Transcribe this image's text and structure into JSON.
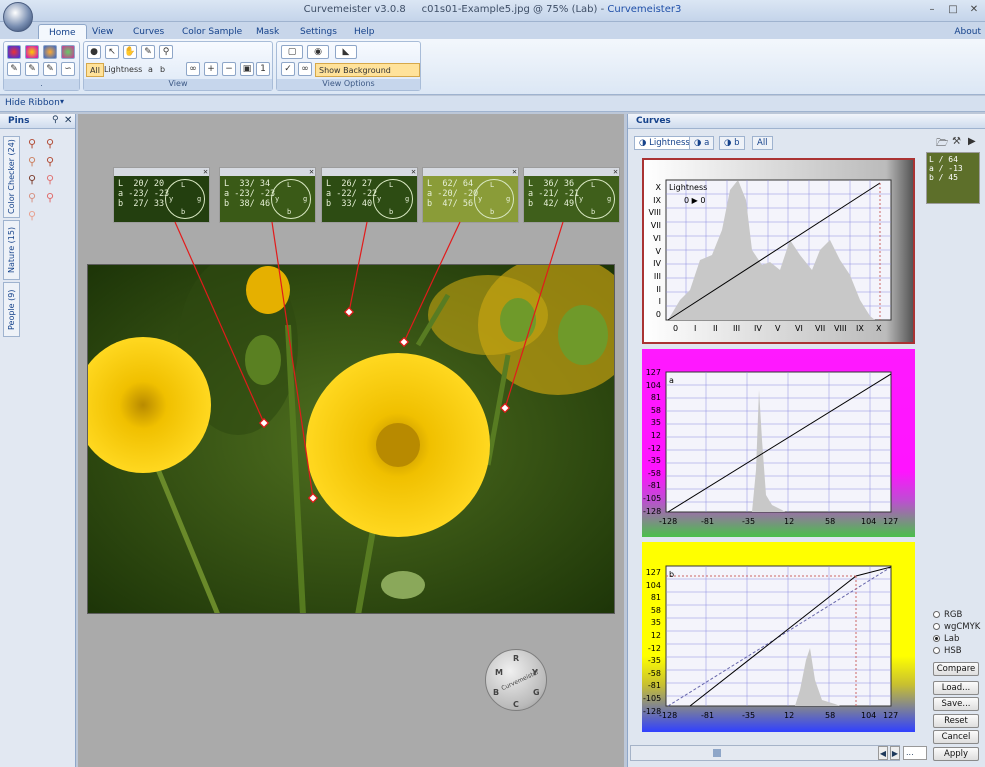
{
  "titlebar": {
    "app": "Curvemeister v3.0.8",
    "doc": "c01s01-Example5.jpg @ 75% (Lab)",
    "separator": "-",
    "brand": "Curvemeister3"
  },
  "tabs": [
    "Home",
    "View",
    "Curves",
    "Color Sample",
    "Mask",
    "Settings",
    "Help"
  ],
  "about": "About",
  "ribbon": {
    "group2_label": "View",
    "group3_label": "View Options",
    "channel_chips": [
      "All",
      "Lightness",
      "a",
      "b"
    ],
    "show_bg": "Show Background Layers",
    "dot_label": "."
  },
  "hide_ribbon": "Hide Ribbon",
  "pins": {
    "title": "Pins",
    "tabs": [
      "Color Checker (24)",
      "Nature (15)",
      "People (9)"
    ]
  },
  "samplers": [
    {
      "L": "L  20/ 20",
      "a": "a -23/ -23",
      "b": "b  27/ 33",
      "bg": "#233f0f"
    },
    {
      "L": "L  33/ 34",
      "a": "a -23/ -23",
      "b": "b  38/ 46",
      "bg": "#3a5a17"
    },
    {
      "L": "L  26/ 27",
      "a": "a -22/ -22",
      "b": "b  33/ 40",
      "bg": "#2d4c13"
    },
    {
      "L": "L  62/ 64",
      "a": "a -20/ -20",
      "b": "b  47/ 56",
      "bg": "#8a9c38"
    },
    {
      "L": "L  36/ 36",
      "a": "a -21/ -21",
      "b": "b  42/ 49",
      "bg": "#3f5f1b"
    }
  ],
  "clock_letters": {
    "L": "L",
    "a": "a",
    "b": "b",
    "y": "y",
    "g": "g"
  },
  "wheel": {
    "letters": [
      "M",
      "R",
      "Y",
      "B",
      "C",
      "G"
    ],
    "text": "Curvemeister"
  },
  "curves": {
    "title": "Curves",
    "tabs": [
      "Lightness",
      "a",
      "b",
      "All"
    ],
    "lightness": {
      "name": "Lightness",
      "io": "0 ▶ 0",
      "ylabels": [
        "X",
        "IX",
        "VIII",
        "VII",
        "VI",
        "V",
        "IV",
        "III",
        "II",
        "I",
        "0"
      ],
      "xlabels": [
        "0",
        "I",
        "II",
        "III",
        "IV",
        "V",
        "VI",
        "VII",
        "VIII",
        "IX",
        "X"
      ]
    },
    "a": {
      "name": "a",
      "ylabels": [
        "127",
        "104",
        "81",
        "58",
        "35",
        "12",
        "-12",
        "-35",
        "-58",
        "-81",
        "-105",
        "-128"
      ],
      "xlabels": [
        "-128",
        "-81",
        "-35",
        "12",
        "58",
        "104",
        "127"
      ]
    },
    "b": {
      "name": "b",
      "ylabels": [
        "127",
        "104",
        "81",
        "58",
        "35",
        "12",
        "-12",
        "-35",
        "-58",
        "-81",
        "-105",
        "-128"
      ],
      "xlabels": [
        "-128",
        "-81",
        "-35",
        "12",
        "58",
        "104",
        "127"
      ]
    }
  },
  "info": {
    "L": "L /  64",
    "a": "a / -13",
    "b": "b /  45"
  },
  "modes": [
    {
      "label": "RGB",
      "selected": false
    },
    {
      "label": "wgCMYK",
      "selected": false
    },
    {
      "label": "Lab",
      "selected": true
    },
    {
      "label": "HSB",
      "selected": false
    }
  ],
  "buttons": {
    "compare": "Compare",
    "load": "Load...",
    "save": "Save...",
    "reset": "Reset",
    "cancel": "Cancel",
    "apply": "Apply"
  },
  "scroll_field": "..."
}
